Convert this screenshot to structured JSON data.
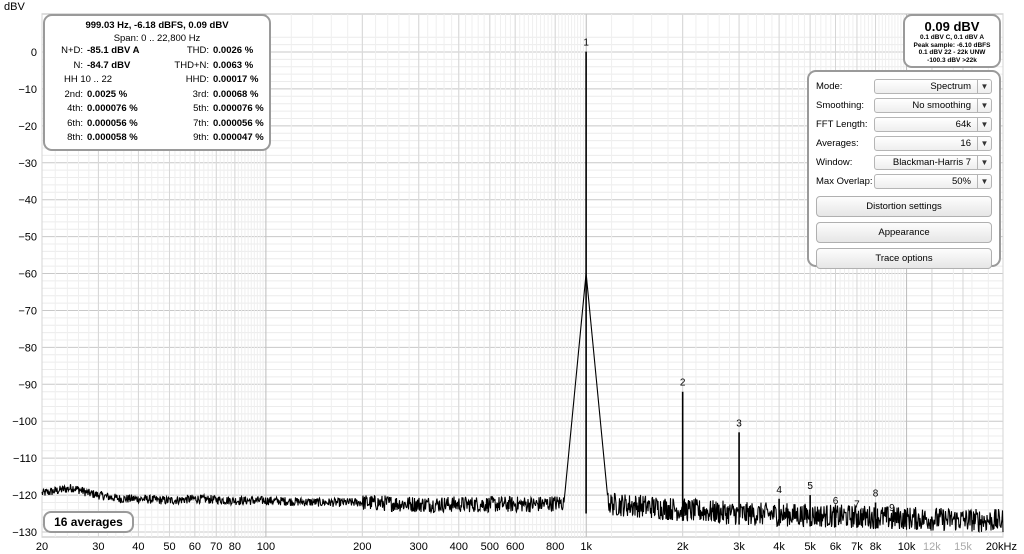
{
  "chart_data": {
    "type": "line",
    "ylabel": "dBV",
    "xscale": "log",
    "xlim": [
      20,
      20000
    ],
    "ylim": [
      -135,
      5
    ],
    "y_ticks": [
      0,
      -10,
      -20,
      -30,
      -40,
      -50,
      -60,
      -70,
      -80,
      -90,
      -100,
      -110,
      -120,
      -130
    ],
    "x_ticks": [
      {
        "v": 20,
        "t": "20"
      },
      {
        "v": 30,
        "t": "30"
      },
      {
        "v": 40,
        "t": "40"
      },
      {
        "v": 50,
        "t": "50"
      },
      {
        "v": 60,
        "t": "60"
      },
      {
        "v": 70,
        "t": "70"
      },
      {
        "v": 80,
        "t": "80"
      },
      {
        "v": 100,
        "t": "100"
      },
      {
        "v": 200,
        "t": "200"
      },
      {
        "v": 300,
        "t": "300"
      },
      {
        "v": 400,
        "t": "400"
      },
      {
        "v": 500,
        "t": "500"
      },
      {
        "v": 600,
        "t": "600"
      },
      {
        "v": 800,
        "t": "800"
      },
      {
        "v": 1000,
        "t": "1k"
      },
      {
        "v": 2000,
        "t": "2k"
      },
      {
        "v": 3000,
        "t": "3k"
      },
      {
        "v": 4000,
        "t": "4k"
      },
      {
        "v": 5000,
        "t": "5k"
      },
      {
        "v": 6000,
        "t": "6k"
      },
      {
        "v": 7000,
        "t": "7k"
      },
      {
        "v": 8000,
        "t": "8k"
      },
      {
        "v": 10000,
        "t": "10k"
      },
      {
        "v": 12000,
        "t": "12k",
        "grey": true
      },
      {
        "v": 15000,
        "t": "15k",
        "grey": true
      },
      {
        "v": 20000,
        "t": "20kHz"
      }
    ],
    "harmonics": [
      {
        "label": "1",
        "f": 999.03,
        "db": 0.1
      },
      {
        "label": "2",
        "f": 2000,
        "db": -92
      },
      {
        "label": "3",
        "f": 3000,
        "db": -103
      },
      {
        "label": "4",
        "f": 4000,
        "db": -121
      },
      {
        "label": "5",
        "f": 5000,
        "db": -120
      },
      {
        "label": "6",
        "f": 6000,
        "db": -124
      },
      {
        "label": "7",
        "f": 7000,
        "db": -125
      },
      {
        "label": "8",
        "f": 8000,
        "db": -122
      },
      {
        "label": "9",
        "f": 9000,
        "db": -126
      }
    ],
    "noise_floor": [
      {
        "f": 20,
        "db": -119.5
      },
      {
        "f": 25,
        "db": -118
      },
      {
        "f": 28,
        "db": -119.5
      },
      {
        "f": 30,
        "db": -120
      },
      {
        "f": 35,
        "db": -121
      },
      {
        "f": 40,
        "db": -121
      },
      {
        "f": 50,
        "db": -121.5
      },
      {
        "f": 60,
        "db": -121
      },
      {
        "f": 80,
        "db": -121.5
      },
      {
        "f": 100,
        "db": -121.5
      },
      {
        "f": 150,
        "db": -122
      },
      {
        "f": 200,
        "db": -122
      },
      {
        "f": 300,
        "db": -122.5
      },
      {
        "f": 400,
        "db": -122.5
      },
      {
        "f": 500,
        "db": -122.5
      },
      {
        "f": 700,
        "db": -122.5
      },
      {
        "f": 900,
        "db": -122
      },
      {
        "f": 1000,
        "db": -122
      },
      {
        "f": 1500,
        "db": -123
      },
      {
        "f": 2000,
        "db": -124
      },
      {
        "f": 3000,
        "db": -125
      },
      {
        "f": 5000,
        "db": -125.5
      },
      {
        "f": 8000,
        "db": -126
      },
      {
        "f": 12000,
        "db": -126.5
      },
      {
        "f": 20000,
        "db": -127
      }
    ]
  },
  "stats": {
    "header": "999.03 Hz, -6.18 dBFS, 0.09 dBV",
    "span": "Span: 0 .. 22,800 Hz",
    "rows": [
      {
        "l1": "N+D:",
        "v1": "-85.1 dBV A",
        "l2": "THD:",
        "v2": "0.0026 %"
      },
      {
        "l1": "N:",
        "v1": "-84.7 dBV",
        "l2": "THD+N:",
        "v2": "0.0063 %"
      },
      {
        "l1": "HH 10 .. 22",
        "v1": "",
        "l2": "HHD:",
        "v2": "0.00017 %"
      },
      {
        "l1": "2nd:",
        "v1": "0.0025 %",
        "l2": "3rd:",
        "v2": "0.00068 %"
      },
      {
        "l1": "4th:",
        "v1": "0.000076 %",
        "l2": "5th:",
        "v2": "0.000076 %"
      },
      {
        "l1": "6th:",
        "v1": "0.000056 %",
        "l2": "7th:",
        "v2": "0.000056 %"
      },
      {
        "l1": "8th:",
        "v1": "0.000058 %",
        "l2": "9th:",
        "v2": "0.000047 %"
      }
    ]
  },
  "level": {
    "value": "0.09 dBV",
    "line1": "0.1 dBV C, 0.1 dBV A",
    "line2": "Peak sample: -6.10 dBFS",
    "line3": "0.1 dBV 22 - 22k UNW",
    "line4": "-100.3 dBV >22k"
  },
  "settings": {
    "mode_label": "Mode:",
    "mode_value": "Spectrum",
    "smoothing_label": "Smoothing:",
    "smoothing_value": "No  smoothing",
    "fft_label": "FFT Length:",
    "fft_value": "64k",
    "averages_label": "Averages:",
    "averages_value": "16",
    "window_label": "Window:",
    "window_value": "Blackman-Harris 7",
    "overlap_label": "Max Overlap:",
    "overlap_value": "50%",
    "distortion_button": "Distortion settings",
    "appearance_button": "Appearance",
    "trace_button": "Trace options"
  },
  "averages_badge": "16 averages"
}
